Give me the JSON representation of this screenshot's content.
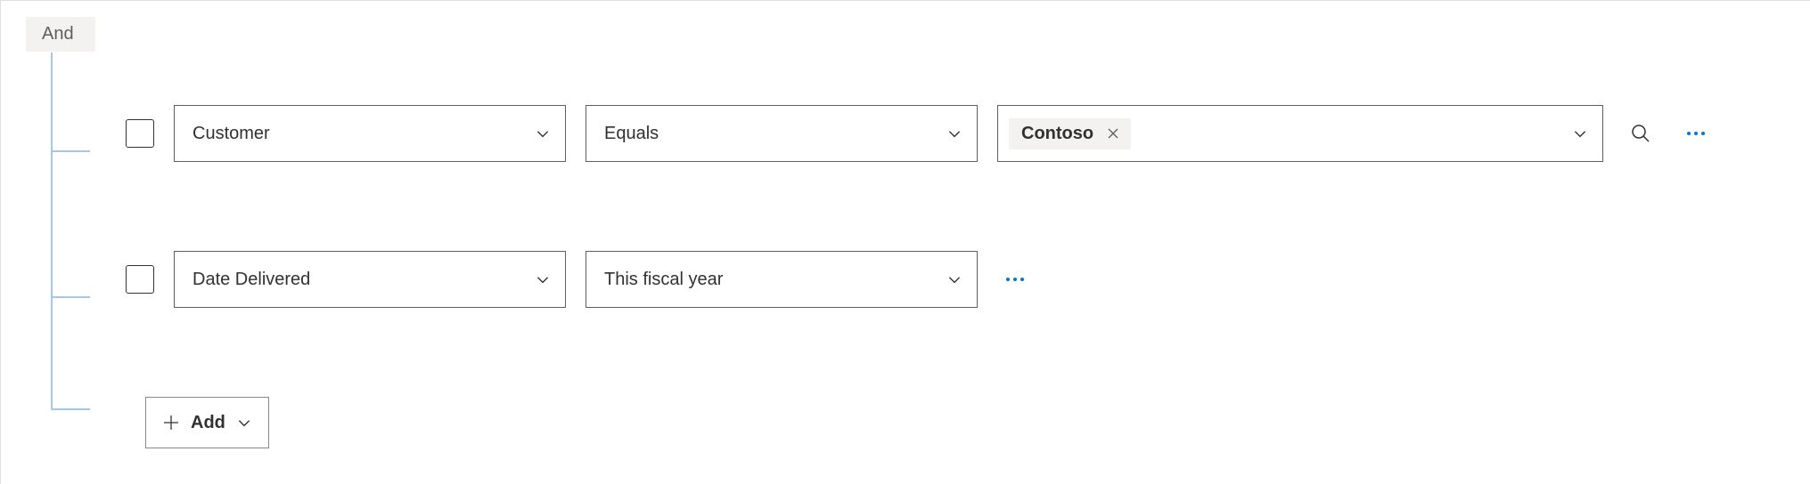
{
  "group": {
    "operator": "And"
  },
  "rows": [
    {
      "field": "Customer",
      "operator": "Equals",
      "value_tag": "Contoso",
      "has_search": true
    },
    {
      "field": "Date Delivered",
      "operator": "This fiscal year",
      "value_tag": null,
      "has_search": false
    }
  ],
  "add_button": {
    "label": "Add"
  }
}
